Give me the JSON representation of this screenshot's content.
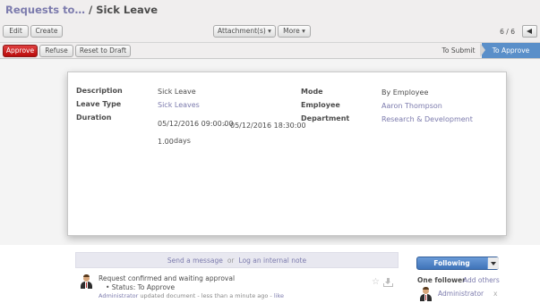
{
  "breadcrumb": {
    "parent": "Requests to…",
    "separator": " / ",
    "current": "Sick Leave"
  },
  "toolbar": {
    "edit_label": "Edit",
    "create_label": "Create",
    "attachments_label": "Attachment(s) ▾",
    "more_label": "More ▾"
  },
  "pager": {
    "value": "6 / 6"
  },
  "statusbar": {
    "approve_label": "Approve",
    "refuse_label": "Refuse",
    "reset_label": "Reset to Draft",
    "stages": [
      {
        "label": "To Submit"
      },
      {
        "label": "To Approve"
      }
    ],
    "active_color": "#5a8fc9"
  },
  "form": {
    "description_label": "Description",
    "description_value": "Sick Leave",
    "leave_type_label": "Leave Type",
    "leave_type_value": "Sick Leaves",
    "duration_label": "Duration",
    "date_from": "05/12/2016 09:00:00",
    "date_sep": "-",
    "date_to": "05/12/2016 18:30:00",
    "days_value": "1.00",
    "days_unit": "days",
    "mode_label": "Mode",
    "mode_value": "By Employee",
    "employee_label": "Employee",
    "employee_value": "Aaron Thompson",
    "department_label": "Department",
    "department_value": "Research & Development"
  },
  "chatter": {
    "send_message": "Send a message",
    "or": "or",
    "log_note": "Log an internal note",
    "message": {
      "title": "Request confirmed and waiting approval",
      "status_text": "• Status: To Approve",
      "author": "Administrator",
      "meta": " updated document - less than a minute ago - ",
      "like": "like"
    },
    "follow_label": "Following",
    "followers_title": "One follower",
    "add_others": "Add others",
    "follower_name": "Administrator",
    "remove": "x"
  },
  "colors": {
    "link": "#7c7bad",
    "approve_button": "#c41414"
  },
  "icons": [
    "pager-prev-icon",
    "star-icon",
    "download-icon",
    "dropdown-caret-icon"
  ]
}
